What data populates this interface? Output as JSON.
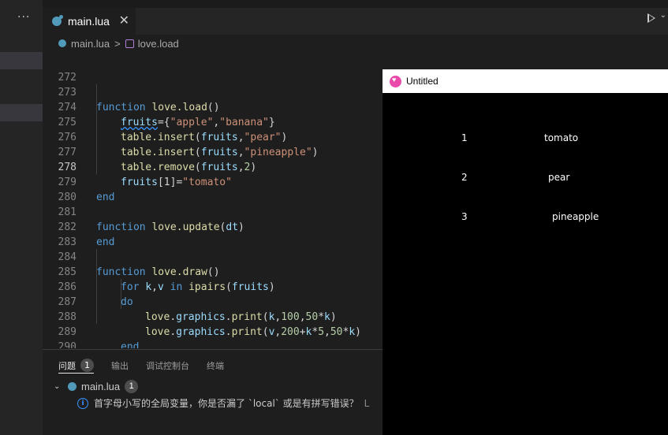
{
  "sidebar": {
    "more_label": "···"
  },
  "tab": {
    "label": "main.lua",
    "close_label": "✕"
  },
  "toolbar": {
    "run_chevron": "⌄"
  },
  "breadcrumb": {
    "file": "main.lua",
    "separator": ">",
    "symbol": "love.load"
  },
  "editor": {
    "active_line": "278",
    "lines": [
      {
        "n": "272"
      },
      {
        "n": "273"
      },
      {
        "n": "274"
      },
      {
        "n": "275"
      },
      {
        "n": "276"
      },
      {
        "n": "277"
      },
      {
        "n": "278"
      },
      {
        "n": "279"
      },
      {
        "n": "280"
      },
      {
        "n": "281"
      },
      {
        "n": "282"
      },
      {
        "n": "283"
      },
      {
        "n": "284"
      },
      {
        "n": "285"
      },
      {
        "n": "286"
      },
      {
        "n": "287"
      },
      {
        "n": "288"
      },
      {
        "n": "289"
      },
      {
        "n": "290"
      }
    ],
    "tokens": {
      "function": "function",
      "love_load": "love.load",
      "parens": "()",
      "fruits": "fruits",
      "eq": "=",
      "brace_open": "{",
      "apple": "\"apple\"",
      "comma": ",",
      "banana": "\"banana\"",
      "brace_close": "}",
      "table_insert": "table.insert",
      "paren_open": "(",
      "paren_close": ")",
      "pear": "\"pear\"",
      "pineapple": "\"pineapple\"",
      "table_remove": "table.remove",
      "two": "2",
      "fruits_index": "[1]",
      "tomato": "\"tomato\"",
      "end": "end",
      "love_update": "love.update",
      "dt": "dt",
      "love_draw": "love.draw",
      "for": "for",
      "k": "k",
      "v": "v",
      "in": "in",
      "ipairs": "ipairs",
      "do": "do",
      "love": "love",
      "dot": ".",
      "graphics": "graphics",
      "print": "print",
      "n100": "100",
      "n50": "50",
      "star": "*",
      "n200": "200",
      "plus": "+",
      "n5": "5"
    }
  },
  "panel": {
    "tabs": [
      {
        "label": "问题",
        "badge": "1"
      },
      {
        "label": "输出"
      },
      {
        "label": "调试控制台"
      },
      {
        "label": "终端"
      }
    ],
    "file_row": {
      "chevron": "⌄",
      "file": "main.lua",
      "count": "1"
    },
    "message": "首字母小写的全局变量，你是否漏了 `local` 或是有拼写错误？",
    "message_suffix": "L"
  },
  "love_window": {
    "title": "Untitled",
    "output": [
      {
        "k": "1",
        "v": "tomato"
      },
      {
        "k": "2",
        "v": "pear"
      },
      {
        "k": "3",
        "v": "pineapple"
      }
    ]
  }
}
